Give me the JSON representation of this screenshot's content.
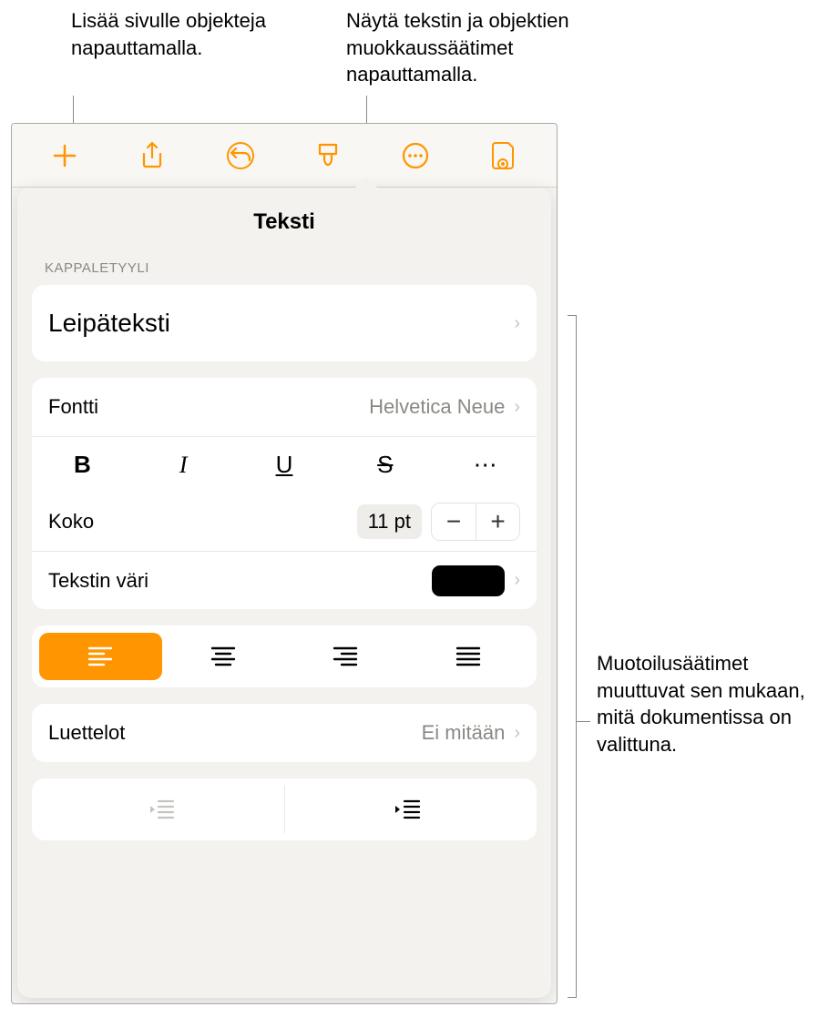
{
  "callouts": {
    "add": "Lisää sivulle objekteja napauttamalla.",
    "format": "Näytä tekstin ja objektien muokkaussäätimet napauttamalla.",
    "panel": "Muotoilusäätimet muuttuvat sen mukaan, mitä dokumentissa on valittuna."
  },
  "toolbar_icons": {
    "add": "plus-icon",
    "share": "share-icon",
    "undo": "undo-icon",
    "format": "brush-icon",
    "more": "more-circle-icon",
    "view": "document-view-icon"
  },
  "popover": {
    "title": "Teksti",
    "section_paragraph": "KAPPALETYYLI",
    "paragraph_style": "Leipäteksti",
    "font_label": "Fontti",
    "font_value": "Helvetica Neue",
    "format_buttons": {
      "bold": "B",
      "italic": "I",
      "underline": "U",
      "strike": "S",
      "more": "⋯"
    },
    "size_label": "Koko",
    "size_value": "11 pt",
    "color_label": "Tekstin väri",
    "color_value": "#000000",
    "lists_label": "Luettelot",
    "lists_value": "Ei mitään"
  }
}
